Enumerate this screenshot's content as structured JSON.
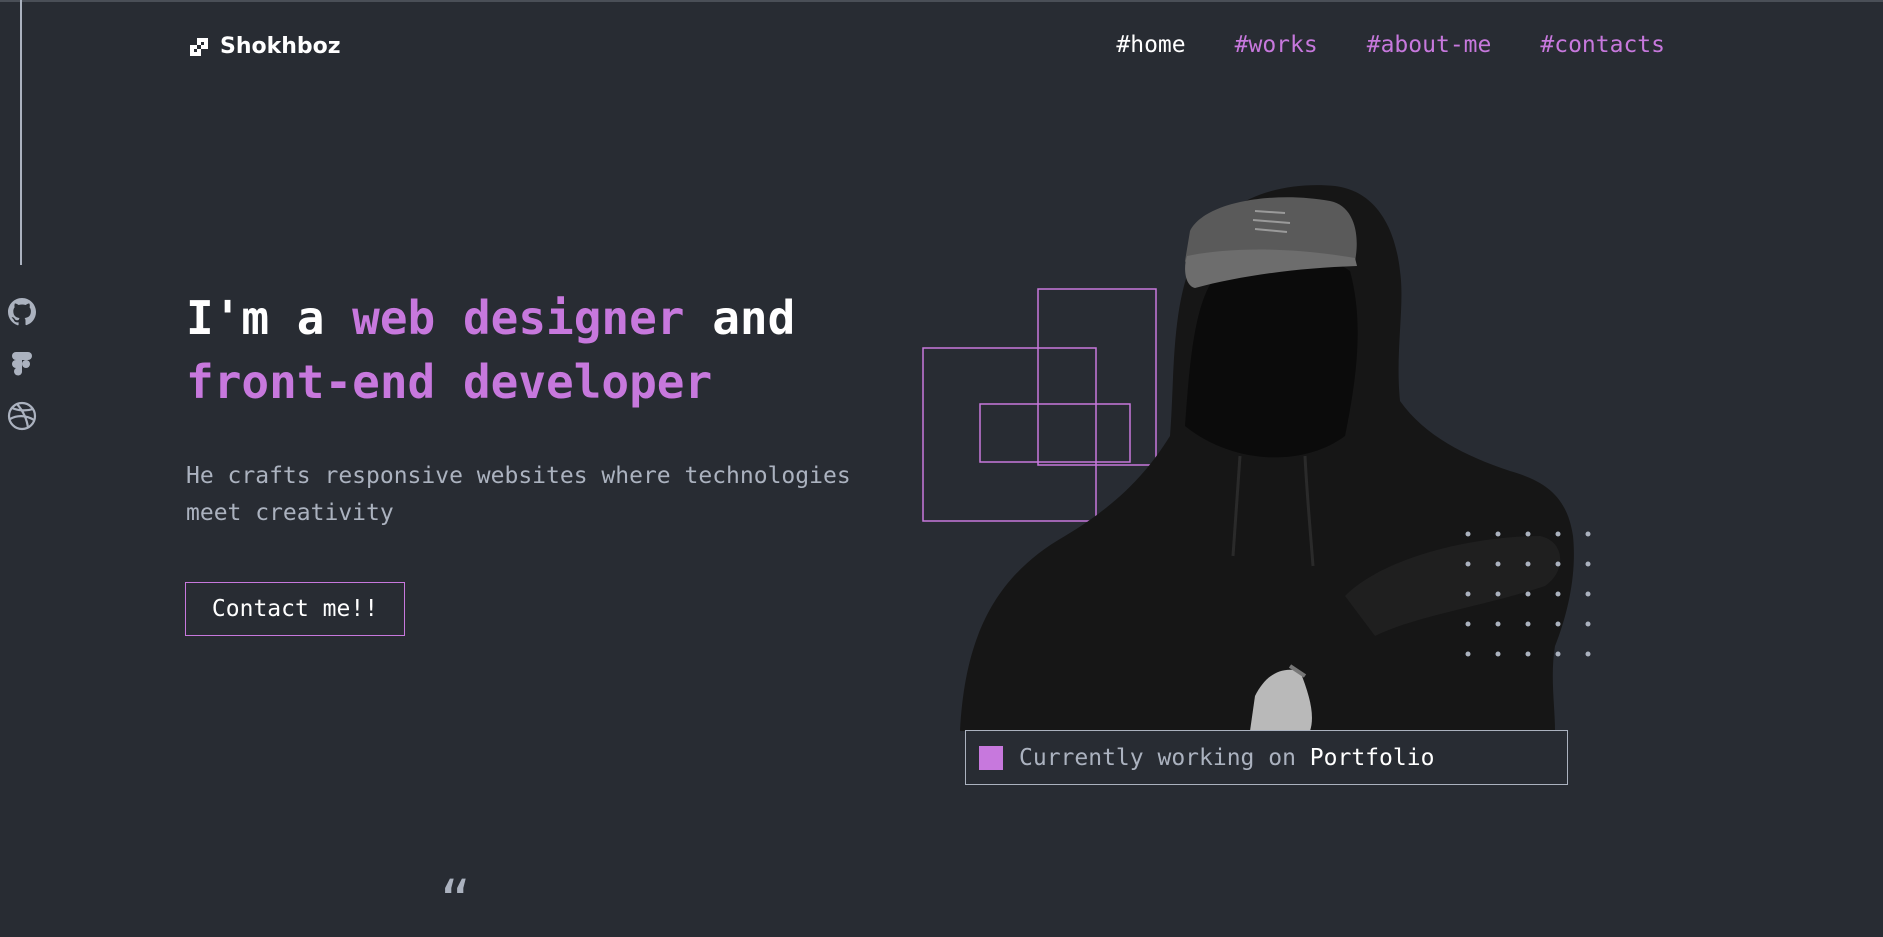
{
  "header": {
    "logo_name": "Shokhboz",
    "logo_icon": "logo-mark-icon"
  },
  "nav": {
    "items": [
      {
        "hash": "#",
        "label": "home",
        "active": true
      },
      {
        "hash": "#",
        "label": "works",
        "active": false
      },
      {
        "hash": "#",
        "label": "about-me",
        "active": false
      },
      {
        "hash": "#",
        "label": "contacts",
        "active": false
      }
    ]
  },
  "socials": [
    "github-icon",
    "figma-icon",
    "dribbble-icon"
  ],
  "hero": {
    "headline_part1": "I'm a ",
    "headline_accent1": "web designer",
    "headline_part2": " and",
    "headline_accent2": "front-end developer",
    "subtitle": "He crafts responsive websites where technologies meet creativity",
    "cta_label": "Contact me!!"
  },
  "status": {
    "prefix": "Currently working on ",
    "project": "Portfolio"
  },
  "quote_glyph": "“",
  "colors": {
    "background": "#282C33",
    "accent": "#C778DD",
    "text": "#FFFFFF",
    "muted": "#ABB2BF"
  }
}
